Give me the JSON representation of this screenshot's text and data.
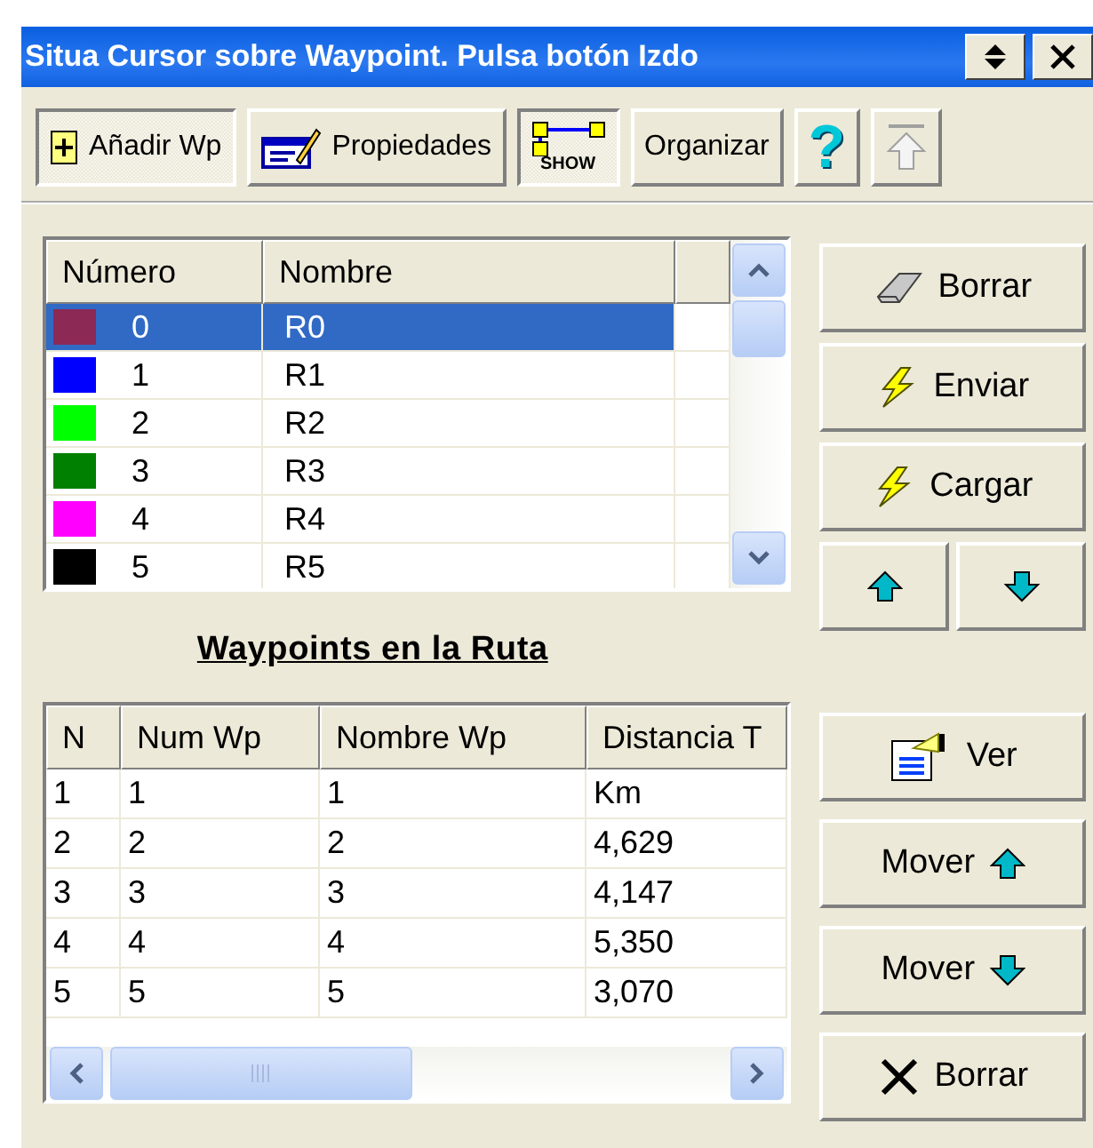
{
  "window": {
    "title": "Situa Cursor sobre Waypoint. Pulsa botón Izdo"
  },
  "toolbar": [
    {
      "kind": "toggle",
      "label": "Añadir Wp",
      "pressed": true
    },
    {
      "kind": "button",
      "label": "Propiedades",
      "pressed": false
    },
    {
      "kind": "toggle",
      "label": "SHOW",
      "pressed": true
    },
    {
      "kind": "button",
      "label": "Organizar",
      "pressed": false
    },
    {
      "kind": "glyph",
      "label": "?",
      "pressed": false
    },
    {
      "kind": "button",
      "disabled": true,
      "pressed": false
    }
  ],
  "routes": {
    "columns": [
      "Número",
      "Nombre"
    ],
    "rows": [
      {
        "number": "0",
        "name": "R0",
        "color": "#8c2a55",
        "selected": true
      },
      {
        "number": "1",
        "name": "R1",
        "color": "#0000ff",
        "selected": false
      },
      {
        "number": "2",
        "name": "R2",
        "color": "#00ff00",
        "selected": false
      },
      {
        "number": "3",
        "name": "R3",
        "color": "#008000",
        "selected": false
      },
      {
        "number": "4",
        "name": "R4",
        "color": "#ff00ff",
        "selected": false
      },
      {
        "number": "5",
        "name": "R5",
        "color": "#000000",
        "selected": false
      }
    ]
  },
  "route_buttons": [
    "Borrar",
    "Enviar",
    "Cargar"
  ],
  "waypoints_heading": "Waypoints en la Ruta",
  "waypoints": {
    "columns": [
      "N",
      "Num Wp",
      "Nombre Wp",
      "Distancia T"
    ],
    "rows": [
      [
        "1",
        "1",
        "1",
        "Km"
      ],
      [
        "2",
        "2",
        "2",
        "4,629"
      ],
      [
        "3",
        "3",
        "3",
        "4,147"
      ],
      [
        "4",
        "4",
        "4",
        "5,350"
      ],
      [
        "5",
        "5",
        "5",
        "3,070"
      ]
    ]
  },
  "waypoint_buttons": [
    "Ver",
    "Mover",
    "Mover",
    "Borrar"
  ]
}
